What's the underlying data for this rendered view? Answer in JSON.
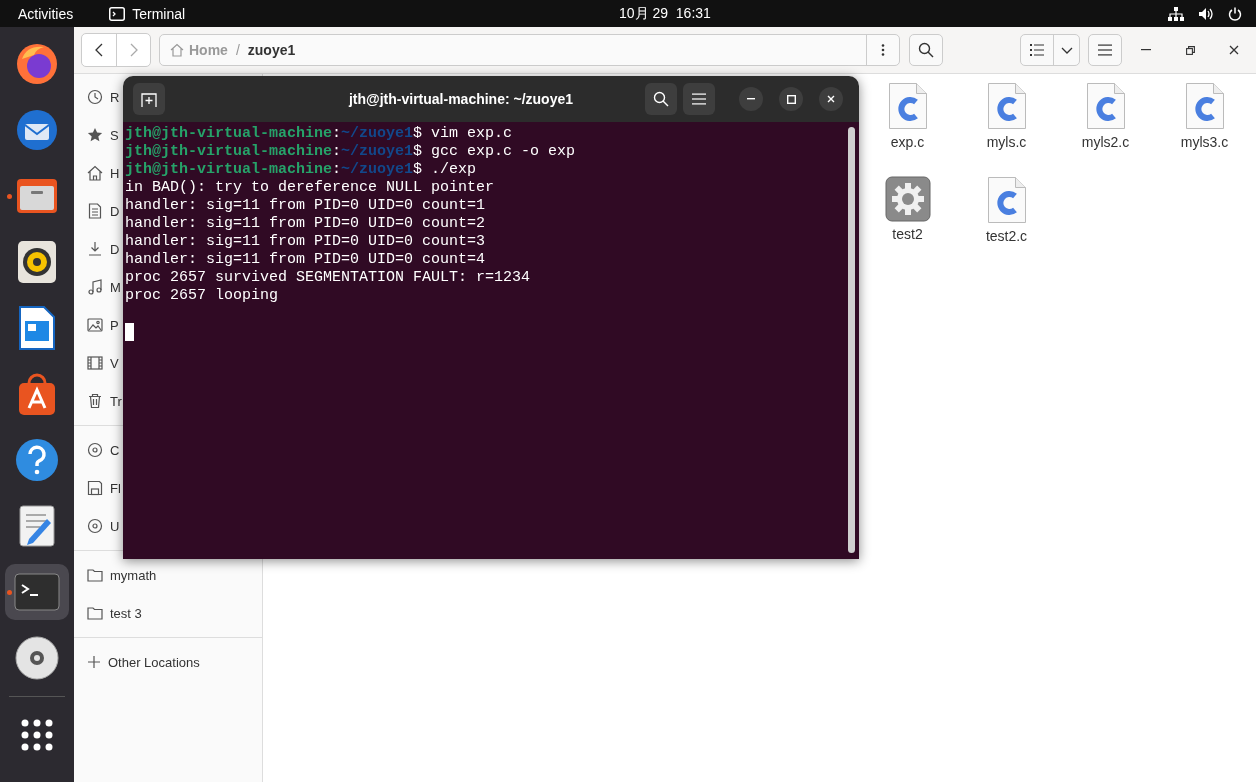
{
  "top_bar": {
    "activities": "Activities",
    "app_name": "Terminal",
    "clock": "10月 29  16:31"
  },
  "dock": {
    "items": [
      {
        "kind": "firefox",
        "running": false,
        "selected": false
      },
      {
        "kind": "mail",
        "running": false,
        "selected": false
      },
      {
        "kind": "files",
        "running": true,
        "selected": false
      },
      {
        "kind": "speaker",
        "running": false,
        "selected": false
      },
      {
        "kind": "writer",
        "running": false,
        "selected": false
      },
      {
        "kind": "store",
        "running": false,
        "selected": false
      },
      {
        "kind": "help",
        "running": false,
        "selected": false
      },
      {
        "kind": "editor",
        "running": false,
        "selected": false
      },
      {
        "kind": "terminal",
        "running": true,
        "selected": true
      },
      {
        "kind": "disc",
        "running": false,
        "selected": false
      },
      {
        "kind": "apps",
        "running": false,
        "selected": false
      }
    ]
  },
  "files_window": {
    "breadcrumb": [
      {
        "kind": "home",
        "label": "Home"
      },
      {
        "kind": "folder",
        "label": "zuoye1"
      }
    ],
    "separator": "/",
    "sidebar": {
      "sections": [
        [
          {
            "kind": "recent",
            "label": "R"
          },
          {
            "kind": "starred",
            "label": "S"
          },
          {
            "kind": "home",
            "label": "H"
          },
          {
            "kind": "document",
            "label": "D"
          },
          {
            "kind": "download",
            "label": "D"
          },
          {
            "kind": "music",
            "label": "M"
          },
          {
            "kind": "picture",
            "label": "P"
          },
          {
            "kind": "video",
            "label": "V"
          },
          {
            "kind": "trash",
            "label": "Tr"
          }
        ],
        [
          {
            "kind": "disc",
            "label": "C"
          },
          {
            "kind": "floppy",
            "label": "Fl"
          },
          {
            "kind": "disc",
            "label": "U"
          }
        ],
        [
          {
            "kind": "folder",
            "label": "mymath"
          },
          {
            "kind": "folder",
            "label": "test 3"
          }
        ]
      ],
      "other_locations": "Other Locations"
    },
    "files": [
      {
        "kind": "c-source",
        "name": "exp.c"
      },
      {
        "kind": "c-source",
        "name": "myls.c"
      },
      {
        "kind": "c-source",
        "name": "myls2.c"
      },
      {
        "kind": "c-source",
        "name": "myls3.c"
      },
      {
        "kind": "executable",
        "name": "test2"
      },
      {
        "kind": "c-source",
        "name": "test2.c"
      }
    ]
  },
  "terminal": {
    "title": "jth@jth-virtual-machine: ~/zuoye1",
    "cursor": true,
    "lines": [
      {
        "kind": "prompt",
        "user": "jth@jth-virtual-machine",
        "sep": ":",
        "path": "~/zuoye1",
        "command": "$ vim exp.c"
      },
      {
        "kind": "prompt",
        "user": "jth@jth-virtual-machine",
        "sep": ":",
        "path": "~/zuoye1",
        "command": "$ gcc exp.c -o exp"
      },
      {
        "kind": "prompt",
        "user": "jth@jth-virtual-machine",
        "sep": ":",
        "path": "~/zuoye1",
        "command": "$ ./exp"
      },
      {
        "kind": "output",
        "text": "in BAD(): try to dereference NULL pointer"
      },
      {
        "kind": "output",
        "text": "handler: sig=11 from PID=0 UID=0 count=1"
      },
      {
        "kind": "output",
        "text": "handler: sig=11 from PID=0 UID=0 count=2"
      },
      {
        "kind": "output",
        "text": "handler: sig=11 from PID=0 UID=0 count=3"
      },
      {
        "kind": "output",
        "text": "handler: sig=11 from PID=0 UID=0 count=4"
      },
      {
        "kind": "output",
        "text": "proc 2657 survived SEGMENTATION FAULT: r=1234"
      },
      {
        "kind": "output",
        "text": "proc 2657 looping"
      }
    ]
  }
}
